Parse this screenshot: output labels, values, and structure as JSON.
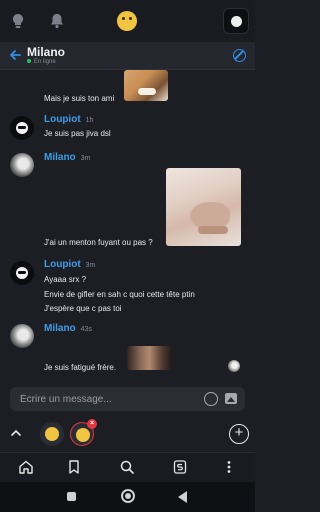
{
  "conversation": {
    "name": "Milano",
    "status": "En ligne"
  },
  "messages": [
    {
      "text": "Mais je suis ton ami"
    },
    {
      "author": "Loupiot",
      "time": "1h",
      "text": "Je suis pas jiva dsl"
    },
    {
      "author": "Milano",
      "time": "3m",
      "text": "J'ai un menton fuyant ou pas ?"
    },
    {
      "author": "Loupiot",
      "time": "3m",
      "lines": [
        "Ayaaa srx ?",
        "Envie de gifler en sah c quoi cette tête ptin",
        "J'espère que c pas toi"
      ]
    },
    {
      "author": "Milano",
      "time": "43s",
      "text": "Je suis fatigué frère."
    }
  ],
  "composer": {
    "placeholder": "Écrire un message..."
  },
  "reaction_bar": {
    "badge": "×"
  },
  "colors": {
    "accent": "#3d9de8",
    "background": "#1d1e24",
    "online": "#2fbf5b",
    "danger": "#e0373f"
  },
  "icons": {
    "top": [
      "lightbulb-icon",
      "bell-icon",
      "smiley-icon",
      "profile-avatar"
    ],
    "nav": [
      "home-icon",
      "bookmark-icon",
      "search-icon",
      "s-badge-icon",
      "more-vertical-icon"
    ],
    "system": [
      "recents-icon",
      "home-circle-icon",
      "back-triangle-icon"
    ]
  }
}
